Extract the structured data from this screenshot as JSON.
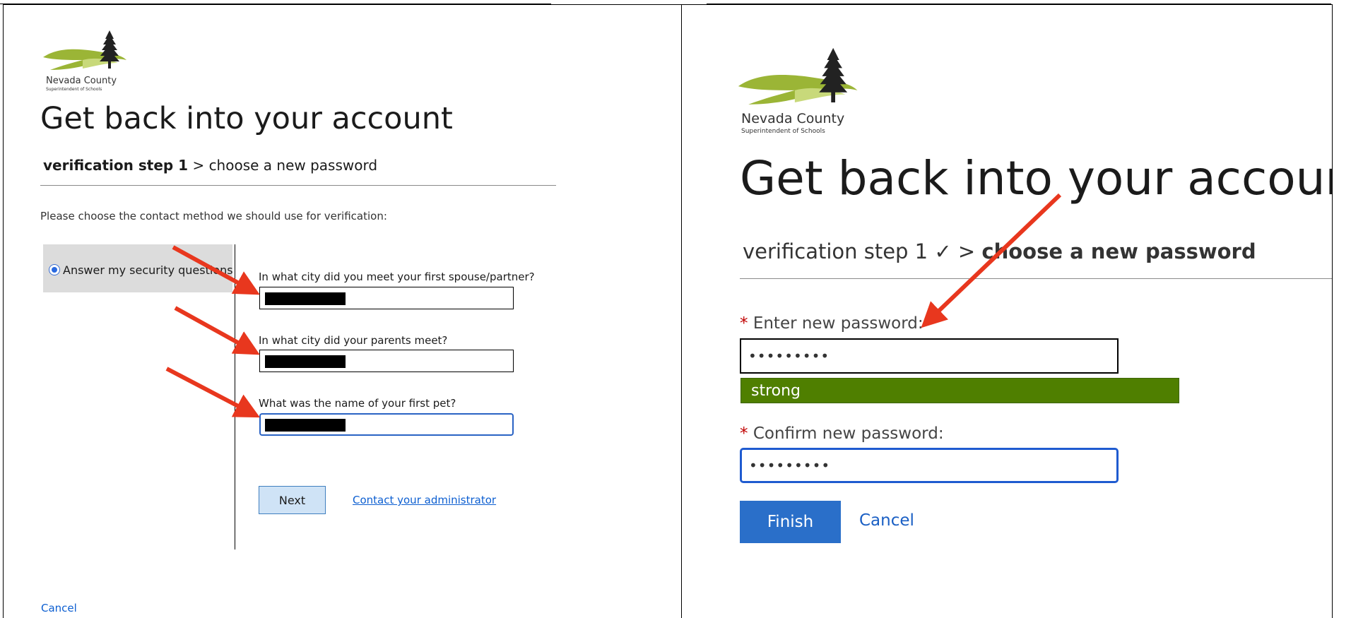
{
  "left": {
    "logo": {
      "org_name": "Nevada County",
      "org_sub": "Superintendent of Schools"
    },
    "title": "Get back into your account",
    "steps": {
      "current": "verification step 1",
      "separator": ">",
      "next": "choose a new password"
    },
    "instruction": "Please choose the contact method we should use for verification:",
    "method": {
      "label": "Answer my security questions",
      "selected": true
    },
    "questions": [
      {
        "label": "In what city did you meet your first spouse/partner?"
      },
      {
        "label": "In what city did your parents meet?"
      },
      {
        "label": "What was the name of your first pet?"
      }
    ],
    "next_button": "Next",
    "contact_link": "Contact your administrator",
    "cancel_link": "Cancel"
  },
  "right": {
    "logo": {
      "org_name": "Nevada County",
      "org_sub": "Superintendent of Schools"
    },
    "title": "Get back into your account",
    "steps": {
      "done": "verification step 1",
      "check": "✓",
      "separator": ">",
      "current": "choose a new password"
    },
    "new_password": {
      "label": "Enter new password:",
      "value": "•••••••••"
    },
    "strength": "strong",
    "confirm_password": {
      "label": "Confirm new password:",
      "value": "•••••••••"
    },
    "required_mark": "*",
    "finish_button": "Finish",
    "cancel_link": "Cancel"
  },
  "colors": {
    "link": "#0d5fd1",
    "strength_bar": "#4f7f00",
    "finish_button": "#2a6fc9",
    "arrow": "#e8371e",
    "logo_green": "#9bb536"
  }
}
